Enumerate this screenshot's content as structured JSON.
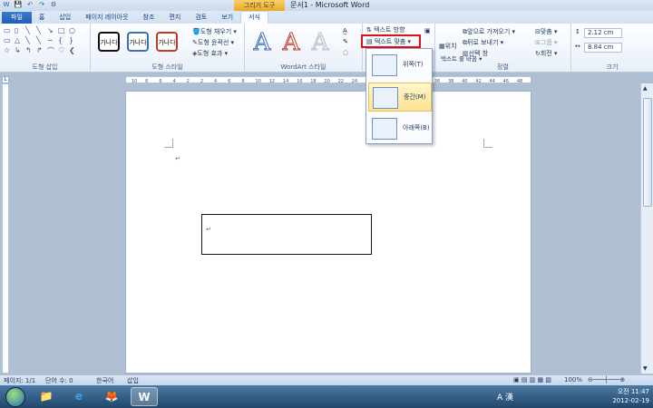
{
  "titlebar": {
    "context_tab": "그리기 도구",
    "document_title": "문서1 - Microsoft Word",
    "qat": [
      "W",
      "💾",
      "↶",
      "↷",
      "⚙"
    ]
  },
  "tabs": [
    "파일",
    "홈",
    "삽입",
    "페이지 레이아웃",
    "참조",
    "편지",
    "검토",
    "보기",
    "서식"
  ],
  "ribbon": {
    "groups": {
      "shape_insert": "도형 삽입",
      "shape_styles": "도형 스타일",
      "wordart_styles": "WordArt 스타일",
      "arrange": "정렬",
      "size": "크기"
    },
    "style_sample_text": "가나다",
    "shape_fill": "도형 채우기 ▾",
    "shape_outline": "도형 윤곽선 ▾",
    "shape_effects": "도형 효과 ▾",
    "text_direction": "텍스트 방향",
    "text_align": "텍스트 맞춤 ▾",
    "position": "위치",
    "text_wrap": "텍스트 줄 바꿈 ▾",
    "bring_forward": "앞으로 가져오기 ▾",
    "send_backward": "뒤로 보내기 ▾",
    "selection_pane": "선택 창",
    "align": "맞춤 ▾",
    "group": "그룹 ▾",
    "rotate": "회전 ▾",
    "height": "2.12 cm",
    "width": "8.84 cm",
    "wordart_letter": "A"
  },
  "dropdown": {
    "items": [
      {
        "label": "위쪽(T)"
      },
      {
        "label": "중간(M)"
      },
      {
        "label": "아래쪽(B)"
      }
    ]
  },
  "ruler": {
    "numbers": [
      "10",
      "8",
      "6",
      "4",
      "2",
      "2",
      "4",
      "6",
      "8",
      "10",
      "12",
      "14",
      "16",
      "18",
      "20",
      "22",
      "24",
      "26",
      "28",
      "30",
      "32",
      "34",
      "36",
      "38",
      "40",
      "42",
      "44",
      "46",
      "48"
    ]
  },
  "status": {
    "page": "페이지: 1/1",
    "words": "단어 수: 0",
    "language": "한국어",
    "insert": "삽입",
    "zoom": "100%"
  },
  "taskbar": {
    "apps": [
      "📁",
      "e",
      "🦊",
      "W"
    ],
    "time": "오전 11:47",
    "date": "2012-02-19",
    "ime": "A 漢"
  },
  "colors": {
    "accent": "#2b579a",
    "highlight_border": "#e01010",
    "context_tab": "#e6a827"
  }
}
